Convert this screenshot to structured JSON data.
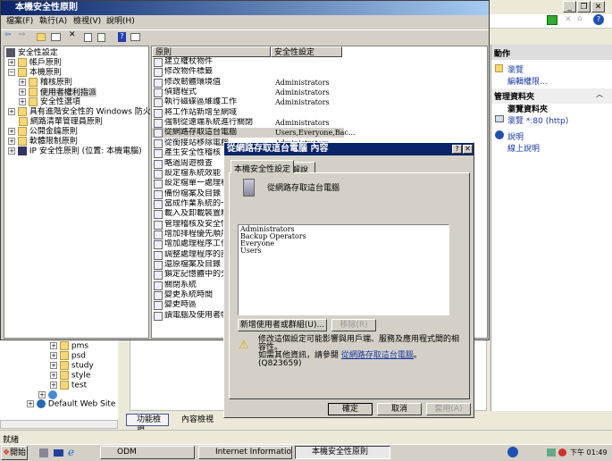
{
  "iis": {
    "actions_header": "動作",
    "browse": "瀏覽",
    "edit_permissions": "編輯權限...",
    "manage_folder": "管理資料夾",
    "browse_folder": "瀏覽資料夾",
    "browse_80": "瀏覽 *:80 (http)",
    "help": "說明",
    "online_help": "線上說明",
    "tree": [
      "pms",
      "psd",
      "study",
      "style",
      "test"
    ],
    "default_site": "Default Web Site",
    "tab_features": "功能檢視",
    "tab_content": "內容檢視",
    "status": "就緒"
  },
  "secpol": {
    "title": "本機安全性原則",
    "menu": [
      "檔案(F)",
      "執行(A)",
      "檢視(V)",
      "說明(H)"
    ],
    "tree": {
      "root": "安全性設定",
      "account": "帳戶原則",
      "local": "本機原則",
      "audit": "稽核原則",
      "rights": "使用者權利指派",
      "options": "安全性選項",
      "firewall": "具有進階安全性的 Windows 防火牆",
      "netlist": "網路清單管理員原則",
      "pubkey": "公開金鑰原則",
      "software": "軟體限制原則",
      "ipsec": "IP 安全性原則 (位置: 本機電腦)"
    },
    "columns": {
      "policy": "原則",
      "setting": "安全性設定"
    },
    "rows": [
      {
        "n": "建立權杖物件",
        "v": ""
      },
      {
        "n": "修改物件標籤",
        "v": ""
      },
      {
        "n": "修改韌體環境值",
        "v": "Administrators"
      },
      {
        "n": "偵錯程式",
        "v": "Administrators"
      },
      {
        "n": "執行磁碟區維護工作",
        "v": "Administrators"
      },
      {
        "n": "將工作站新增至網域",
        "v": ""
      },
      {
        "n": "強制從遠端系統進行關閉",
        "v": "Administrators"
      },
      {
        "n": "從網路存取這台電腦",
        "v": "Users,Everyone,Bac..."
      },
      {
        "n": "從銜接站移除電腦",
        "v": "Administrators"
      },
      {
        "n": "產生安全性稽核",
        "v": ""
      },
      {
        "n": "略過周遊檢查",
        "v": ""
      },
      {
        "n": "設定檔系統效能",
        "v": ""
      },
      {
        "n": "設定檔單一處理程序",
        "v": ""
      },
      {
        "n": "備份檔案及目錄",
        "v": ""
      },
      {
        "n": "當成作業系統的一部分",
        "v": ""
      },
      {
        "n": "載入及卸載裝置驅動程式",
        "v": ""
      },
      {
        "n": "管理稽核及安全性記錄",
        "v": ""
      },
      {
        "n": "增加排程優先順序",
        "v": ""
      },
      {
        "n": "增加處理程序工作組",
        "v": ""
      },
      {
        "n": "調整處理程序的記憶體配額",
        "v": ""
      },
      {
        "n": "還原檔案及目錄",
        "v": ""
      },
      {
        "n": "鎖定記憶體中的分頁",
        "v": ""
      },
      {
        "n": "關閉系統",
        "v": ""
      },
      {
        "n": "變更系統時間",
        "v": ""
      },
      {
        "n": "變更時區",
        "v": ""
      },
      {
        "n": "讀電腦及使用者帳戶",
        "v": ""
      }
    ]
  },
  "dialog": {
    "title": "從網路存取這台電腦 內容",
    "tab_local": "本機安全性設定",
    "tab_explain": "解說",
    "policy_name": "從網路存取這台電腦",
    "members": [
      "Administrators",
      "Backup Operators",
      "Everyone",
      "Users"
    ],
    "add": "新增使用者或群組(U)...",
    "remove": "移除(R)",
    "warning": "修改這個設定可能影響與用戶端、服務及應用程式間的相容性。",
    "more_info": "如需其他資訊，請參閱",
    "link": "從網路存取這台電腦",
    "kb": "。(Q823659)",
    "ok": "確定",
    "cancel": "取消",
    "apply": "套用(A)"
  },
  "taskbar": {
    "start": "開始",
    "tasks": [
      "ODM",
      "Internet Information Servi...",
      "本機安全性原則"
    ],
    "clock": "下午 01:49"
  }
}
